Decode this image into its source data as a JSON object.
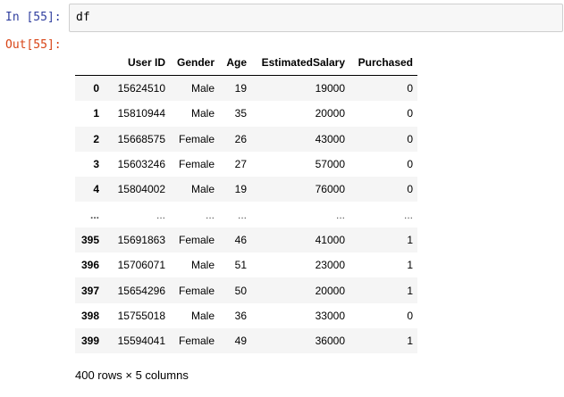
{
  "input_cell": {
    "prompt": "In [55]:",
    "code": "df"
  },
  "output_cell": {
    "prompt": "Out[55]:"
  },
  "dataframe": {
    "columns": [
      "User ID",
      "Gender",
      "Age",
      "EstimatedSalary",
      "Purchased"
    ],
    "rows": [
      {
        "index": "0",
        "cells": [
          "15624510",
          "Male",
          "19",
          "19000",
          "0"
        ]
      },
      {
        "index": "1",
        "cells": [
          "15810944",
          "Male",
          "35",
          "20000",
          "0"
        ]
      },
      {
        "index": "2",
        "cells": [
          "15668575",
          "Female",
          "26",
          "43000",
          "0"
        ]
      },
      {
        "index": "3",
        "cells": [
          "15603246",
          "Female",
          "27",
          "57000",
          "0"
        ]
      },
      {
        "index": "4",
        "cells": [
          "15804002",
          "Male",
          "19",
          "76000",
          "0"
        ]
      },
      {
        "index": "...",
        "cells": [
          "...",
          "...",
          "...",
          "...",
          "..."
        ]
      },
      {
        "index": "395",
        "cells": [
          "15691863",
          "Female",
          "46",
          "41000",
          "1"
        ]
      },
      {
        "index": "396",
        "cells": [
          "15706071",
          "Male",
          "51",
          "23000",
          "1"
        ]
      },
      {
        "index": "397",
        "cells": [
          "15654296",
          "Female",
          "50",
          "20000",
          "1"
        ]
      },
      {
        "index": "398",
        "cells": [
          "15755018",
          "Male",
          "36",
          "33000",
          "0"
        ]
      },
      {
        "index": "399",
        "cells": [
          "15594041",
          "Female",
          "49",
          "36000",
          "1"
        ]
      }
    ],
    "shape_note": "400 rows × 5 columns"
  }
}
